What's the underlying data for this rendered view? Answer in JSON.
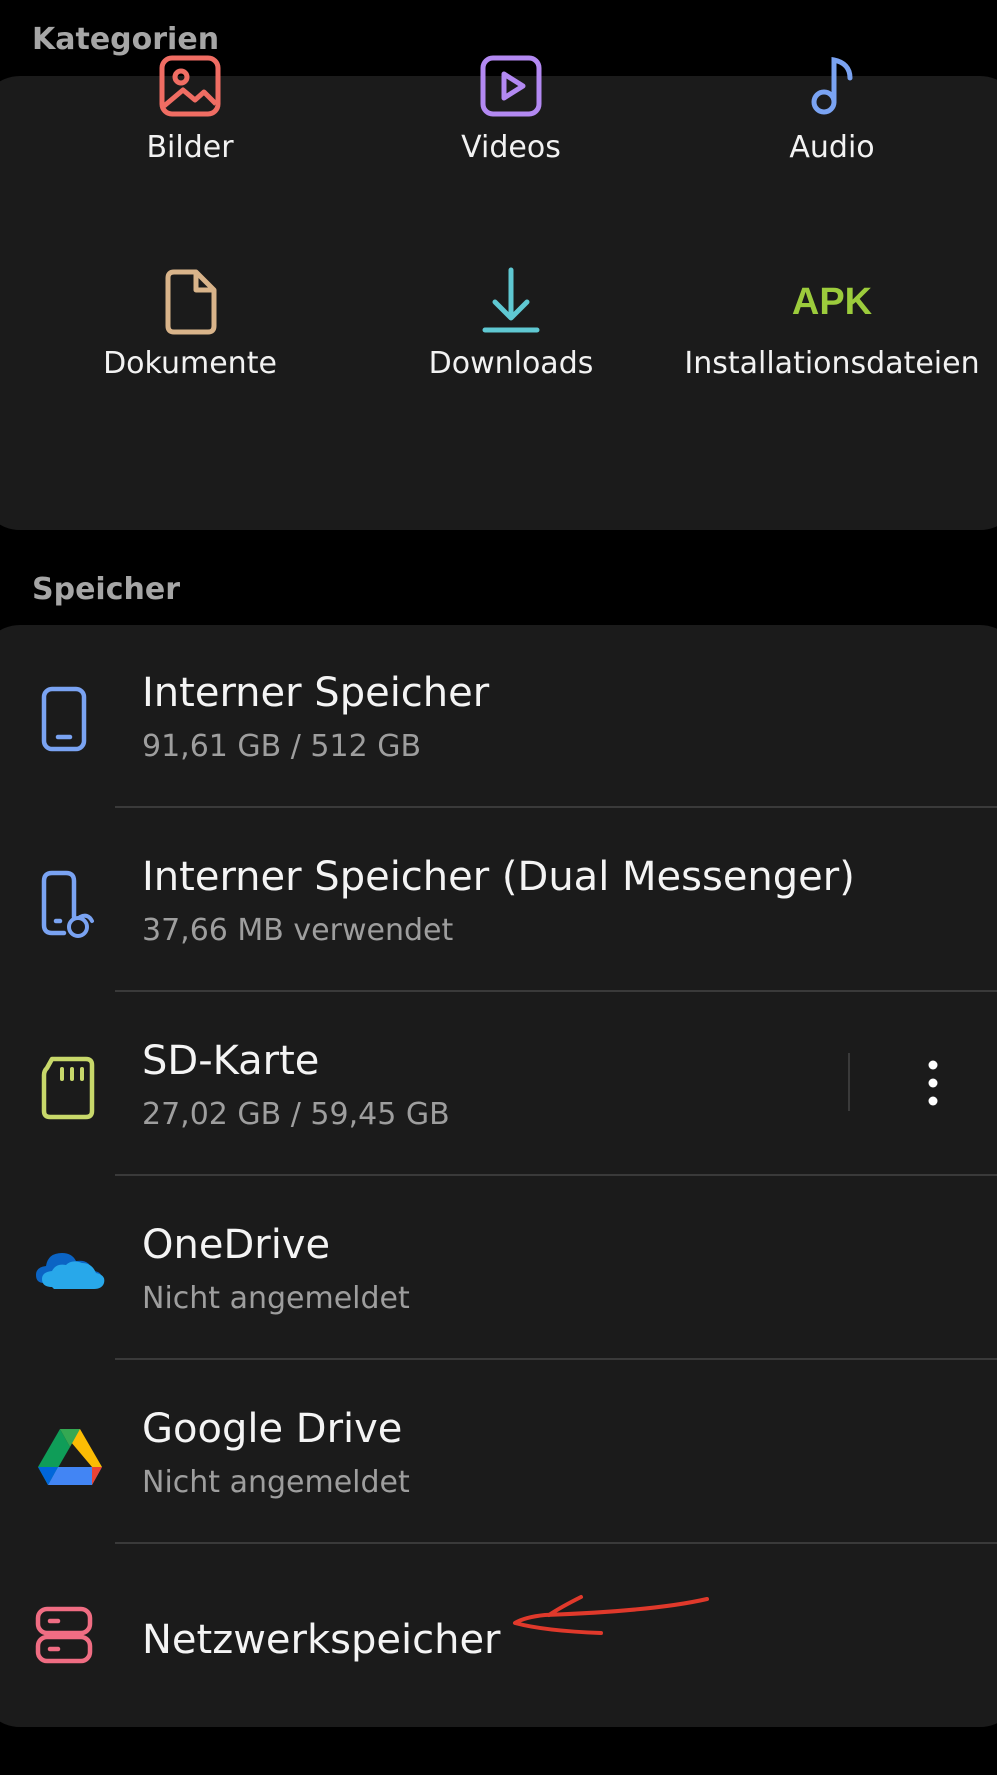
{
  "sections": {
    "categories_title": "Kategorien",
    "storage_title": "Speicher"
  },
  "categories": [
    {
      "label": "Bilder",
      "icon": "image-icon",
      "color": "#f06d63"
    },
    {
      "label": "Videos",
      "icon": "video-play-icon",
      "color": "#b389f2"
    },
    {
      "label": "Audio",
      "icon": "music-note-icon",
      "color": "#7aa3f2"
    },
    {
      "label": "Dokumente",
      "icon": "document-icon",
      "color": "#d9b48a"
    },
    {
      "label": "Downloads",
      "icon": "download-icon",
      "color": "#5fc8d2"
    },
    {
      "label": "Installationsdateien",
      "icon": "apk-icon",
      "icon_text": "APK",
      "color": "#9ccc3c"
    }
  ],
  "storage": [
    {
      "title": "Interner Speicher",
      "subtitle": "91,61 GB / 512 GB",
      "icon": "phone-icon",
      "color": "#7aa3f2"
    },
    {
      "title": "Interner Speicher (Dual Messenger)",
      "subtitle": "37,66 MB verwendet",
      "icon": "dual-messenger-phone-icon",
      "color": "#7aa3f2"
    },
    {
      "title": "SD-Karte",
      "subtitle": "27,02 GB / 59,45 GB",
      "icon": "sd-card-icon",
      "color": "#c8d86a"
    },
    {
      "title": "OneDrive",
      "subtitle": "Nicht angemeldet",
      "icon": "onedrive-icon",
      "color": "#1a7fd8"
    },
    {
      "title": "Google Drive",
      "subtitle": "Nicht angemeldet",
      "icon": "google-drive-icon",
      "color": "#34a853"
    },
    {
      "title": "Netzwerkspeicher",
      "subtitle": "",
      "icon": "network-storage-icon",
      "color": "#f06d83"
    }
  ],
  "more_options_icon": "more-vertical-icon",
  "annotation": {
    "icon": "red-arrow-annotation",
    "color": "#e0392b"
  }
}
